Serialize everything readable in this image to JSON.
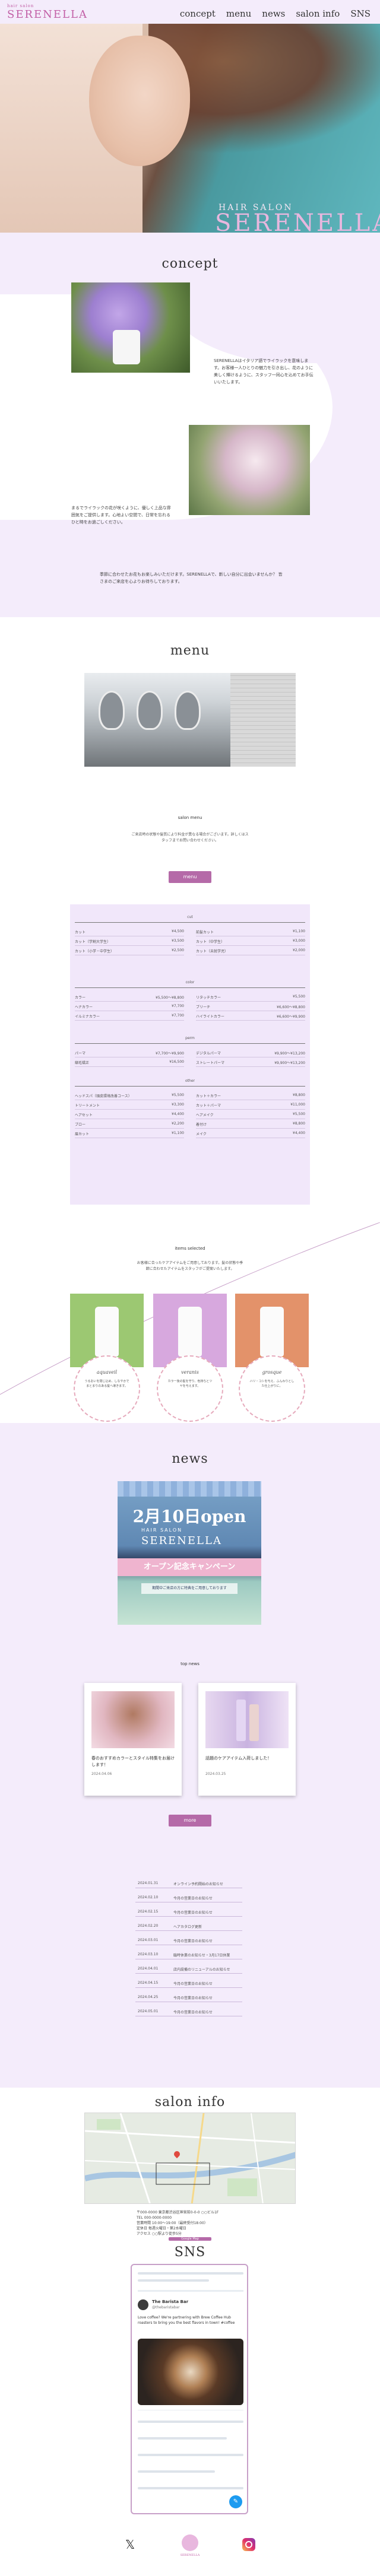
{
  "header": {
    "logo_top": "hair salon",
    "logo_main": "SERENELLA",
    "nav": [
      "concept",
      "menu",
      "news",
      "salon info",
      "SNS"
    ]
  },
  "hero": {
    "tagline": "HAIR SALON",
    "brand": "SERENELLA"
  },
  "concept": {
    "title": "concept",
    "para1": "SERENELLAはイタリア語でライラックを意味します。お客様一人ひとりの魅力を引き出し、花のように美しく輝けるように、スタッフ一同心を込めてお手伝いいたします。",
    "para2": "まるでライラックの花が咲くように、優しく上品な雰囲気をご提供します。心地よい空間で、日常を忘れるひと時をお過ごしください。",
    "para3": "季節に合わせたお花もお楽しみいただけます。SERENELLAで、新しい自分に出会いませんか？ 皆さまのご来店を心よりお待ちしております。"
  },
  "menu": {
    "title": "menu",
    "sub_heading": "salon menu",
    "intro": "ご来店時の状態や髪質により料金が異なる場合がございます。詳しくはスタッフまでお問い合わせください。",
    "button": "menu",
    "categories": [
      {
        "name": "cut",
        "rows": [
          [
            "カット",
            "¥4,500",
            "前髪カット",
            "¥1,100"
          ],
          [
            "カット（学割大学生）",
            "¥3,500",
            "カット（中学生）",
            "¥3,000"
          ],
          [
            "カット（小学・中学生）",
            "¥2,500",
            "カット（未就学児）",
            "¥2,000"
          ]
        ]
      },
      {
        "name": "color",
        "rows": [
          [
            "カラー",
            "¥5,500〜¥8,800",
            "リタッチカラー",
            "¥5,500"
          ],
          [
            "ヘナカラー",
            "¥7,700",
            "ブリーチ",
            "¥6,600〜¥8,800"
          ],
          [
            "イルミナカラー",
            "¥7,700",
            "ハイライトカラー",
            "¥6,600〜¥9,900"
          ]
        ]
      },
      {
        "name": "perm",
        "rows": [
          [
            "パーマ",
            "¥7,700〜¥9,900",
            "デジタルパーマ",
            "¥9,900〜¥13,200"
          ],
          [
            "縮毛矯正",
            "¥16,500",
            "ストレートパーマ",
            "¥9,900〜¥13,200"
          ]
        ]
      },
      {
        "name": "other",
        "rows": [
          [
            "ヘッドスパ（頭皮環境改善コース）",
            "¥5,500",
            "カット＋カラー",
            "¥8,800"
          ],
          [
            "トリートメント",
            "¥3,300",
            "カット＋パーマ",
            "¥11,000"
          ],
          [
            "ヘアセット",
            "¥4,400",
            "ヘアメイク",
            "¥5,500"
          ],
          [
            "ブロー",
            "¥2,200",
            "着付け",
            "¥8,800"
          ],
          [
            "眉カット",
            "¥1,100",
            "メイク",
            "¥4,400"
          ]
        ]
      }
    ],
    "items_heading": "items selected",
    "items_intro": "お客様に合ったケアアイテムをご用意しております。髪の状態や季節に合わせたアイテムをスタッフがご提案いたします。",
    "products": [
      {
        "name": "aquaveil",
        "desc": "うるおいを閉じ込め、しなやかでまとまりのある髪へ導きます。",
        "color": "#9cc872"
      },
      {
        "name": "veranis",
        "desc": "カラー後の髪を守り、色持ちとツヤを与えます。",
        "color": "#d7a8de"
      },
      {
        "name": "grosque",
        "desc": "ハリ・コシを与え、ふんわりとした仕上がりに。",
        "color": "#e3926a"
      }
    ]
  },
  "news": {
    "title": "news",
    "banner_line1": "2月10日open",
    "banner_line2": "HAIR SALON",
    "banner_line3": "SERENELLA",
    "banner_line4": "オープン記念キャンペーン",
    "banner_line5": "期間中ご来店の方に特典をご用意しております",
    "top_heading": "top news",
    "cards": [
      {
        "title": "春のおすすめカラーとスタイル特集をお届けします！",
        "date": "2024.04.06"
      },
      {
        "title": "話題のケアアイテム入荷しました！",
        "date": "2024.03.25"
      }
    ],
    "more": "more",
    "list": [
      [
        "2024.01.31",
        "オンライン予約開始のお知らせ"
      ],
      [
        "2024.02.10",
        "今月の営業日のお知らせ"
      ],
      [
        "2024.02.15",
        "今月の営業日のお知らせ"
      ],
      [
        "2024.02.20",
        "ヘアカタログ更新"
      ],
      [
        "2024.03.01",
        "今月の営業日のお知らせ"
      ],
      [
        "2024.03.10",
        "臨時休業のお知らせ・3月17日休業"
      ],
      [
        "2024.04.01",
        "店内設備のリニューアルのお知らせ"
      ],
      [
        "2024.04.15",
        "今月の営業日のお知らせ"
      ],
      [
        "2024.04.25",
        "今月の営業日のお知らせ"
      ],
      [
        "2024.05.01",
        "今月の営業日のお知らせ"
      ]
    ]
  },
  "salon_info": {
    "title": "salon info",
    "address": "〒000-0000 東京都渋谷区神宮前0-0-0 ○○ビル1F",
    "tel": "TEL 000-0000-0000",
    "hours": "営業時間 10:00〜19:00（最終受付18:00）",
    "holiday": "定休日 毎週火曜日・第2水曜日",
    "access": "アクセス ○○駅より徒歩5分",
    "map_button": "Google Map"
  },
  "sns": {
    "title": "SNS",
    "account": "The Barista Bar",
    "handle": "@thebaristabar",
    "tweet": "Love coffee? We're partnering with Brew Coffee Hub roasters to bring you the best flavors in town! #coffee",
    "footer_logo": "SERENELLA"
  },
  "colors": {
    "accent": "#c25fa6",
    "button": "#b56aa8",
    "lavender": "#f4ecfb"
  }
}
